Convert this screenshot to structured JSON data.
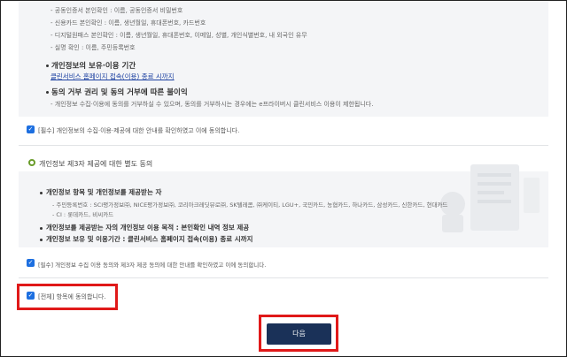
{
  "box1": {
    "items": [
      "- 공동인증서 본인확인 : 이름, 공동인증서 비밀번호",
      "- 신용카드 본인확인 : 이름, 생년월일, 휴대폰번호, 카드번호",
      "- 디지털원패스 본인확인 : 이름, 생년월일, 휴대폰번호, 이메일, 성별, 개인식별번호, 내 외국인 유무",
      "- 실명 확인 : 이름, 주민등록번호"
    ],
    "section1_title": "개인정보의 보유·이용 기간",
    "section1_link": "클린서비스 홈페이지 접속(이용) 종료 시까지",
    "section2_title": "동의 거부 권리 및 동의 거부에 따른 불이익",
    "section2_text": "- 개인정보 수집·이용에 동의를 거부하실 수 있으며, 동의를 거부하시는 경우에는 e프라이버시 클린서비스 이용이 제한됩니다."
  },
  "consent1_label": "[필수] 개인정보의 수집·이용·제공에 대한 안내를 확인하였고 이에 동의합니다.",
  "third_party_heading": "개인정보 제3자 제공에 대한 별도 동의",
  "box2": {
    "title1": "개인정보 항목 및 개인정보를 제공받는 자",
    "sub1": "- 주민등록번호 : SCI평가정보㈜, NICE평가정보㈜, 코리아크레딧뷰로㈜, SK텔레콤, ㈜케이티, LGU+, 국민카드, 농협카드, 하나카드, 삼성카드, 신한카드, 현대카드",
    "sub2": "- CI : 롯데카드, 비씨카드",
    "title2": "개인정보를 제공받는 자의 개인정보 이용 목적 : 본인확인 내역 정보 제공",
    "title3": "개인정보 보유 및 이용기간 : 클린서비스 홈페이지 접속(이용) 종료 시까지"
  },
  "consent2_label": "[필수] 개인정보 수집 이용 동의와 제3자 제공 동의에 대한 안내를 확인하였고 이에 동의합니다.",
  "all_agree_label": "[전체] 항목에 동의합니다.",
  "next_button": "다음",
  "colors": {
    "checkbox": "#1d6fe0",
    "button": "#1a3158",
    "highlight": "#e01919",
    "radio": "#6a9c2b"
  }
}
